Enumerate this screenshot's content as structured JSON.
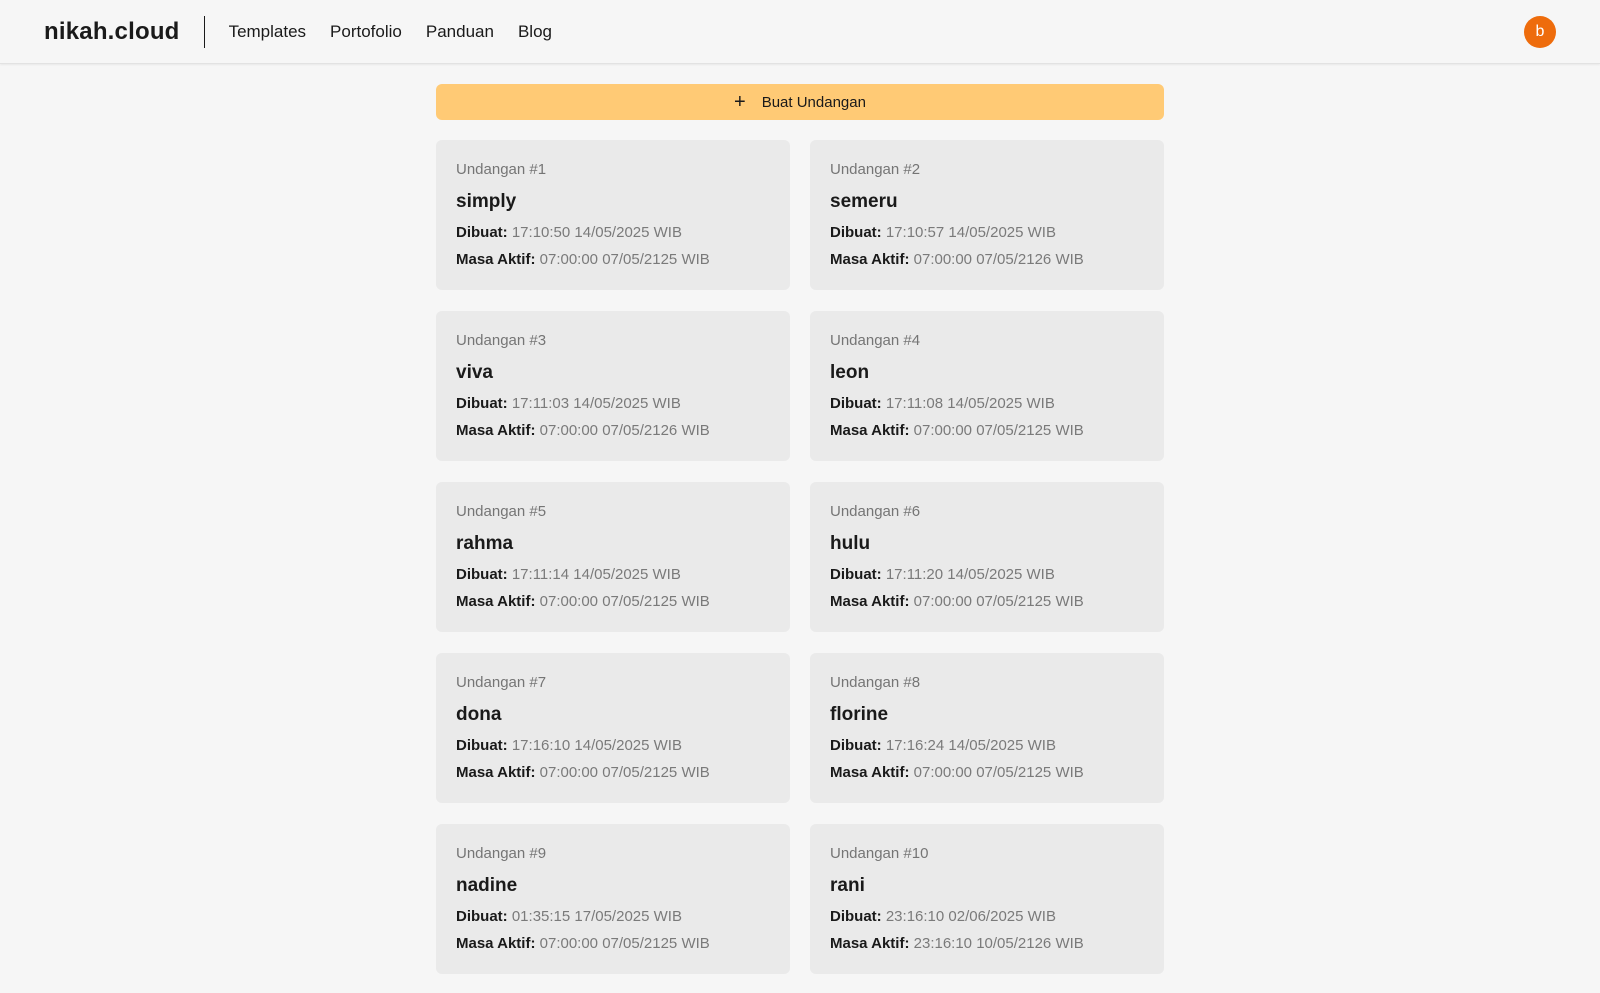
{
  "header": {
    "logo": "nikah.cloud",
    "nav": [
      "Templates",
      "Portofolio",
      "Panduan",
      "Blog"
    ],
    "avatar_initial": "b",
    "avatar_color": "#ee6c0c"
  },
  "actions": {
    "create_label": "Buat Undangan",
    "create_icon": "plus-icon",
    "accent": "#ffca75"
  },
  "labels": {
    "created": "Dibuat:",
    "active": "Masa Aktif:"
  },
  "invitations": [
    {
      "number": "Undangan #1",
      "name": "simply",
      "created": "17:10:50 14/05/2025 WIB",
      "active": "07:00:00 07/05/2125 WIB"
    },
    {
      "number": "Undangan #2",
      "name": "semeru",
      "created": "17:10:57 14/05/2025 WIB",
      "active": "07:00:00 07/05/2126 WIB"
    },
    {
      "number": "Undangan #3",
      "name": "viva",
      "created": "17:11:03 14/05/2025 WIB",
      "active": "07:00:00 07/05/2126 WIB"
    },
    {
      "number": "Undangan #4",
      "name": "leon",
      "created": "17:11:08 14/05/2025 WIB",
      "active": "07:00:00 07/05/2125 WIB"
    },
    {
      "number": "Undangan #5",
      "name": "rahma",
      "created": "17:11:14 14/05/2025 WIB",
      "active": "07:00:00 07/05/2125 WIB"
    },
    {
      "number": "Undangan #6",
      "name": "hulu",
      "created": "17:11:20 14/05/2025 WIB",
      "active": "07:00:00 07/05/2125 WIB"
    },
    {
      "number": "Undangan #7",
      "name": "dona",
      "created": "17:16:10 14/05/2025 WIB",
      "active": "07:00:00 07/05/2125 WIB"
    },
    {
      "number": "Undangan #8",
      "name": "florine",
      "created": "17:16:24 14/05/2025 WIB",
      "active": "07:00:00 07/05/2125 WIB"
    },
    {
      "number": "Undangan #9",
      "name": "nadine",
      "created": "01:35:15 17/05/2025 WIB",
      "active": "07:00:00 07/05/2125 WIB"
    },
    {
      "number": "Undangan #10",
      "name": "rani",
      "created": "23:16:10 02/06/2025 WIB",
      "active": "23:16:10 10/05/2126 WIB"
    }
  ]
}
